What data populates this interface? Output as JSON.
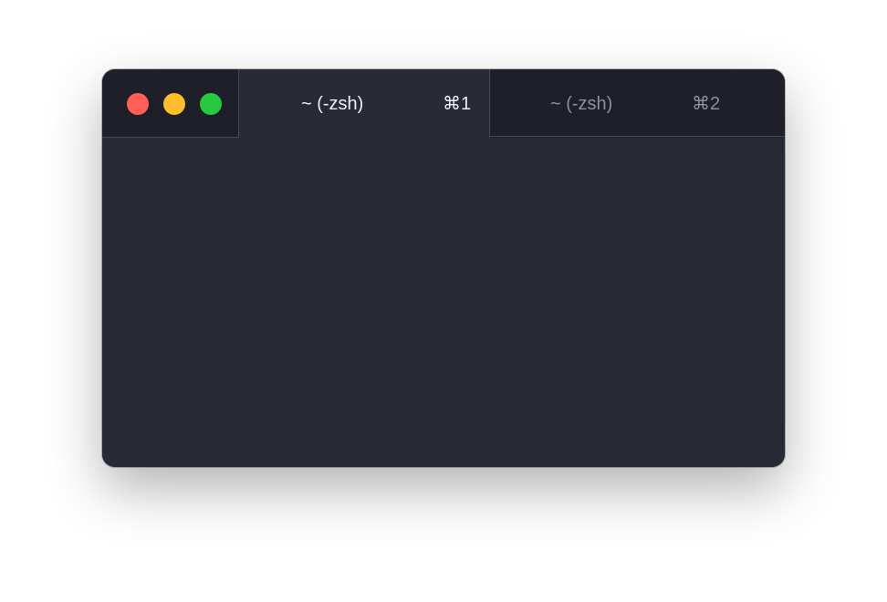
{
  "window": {
    "background_color": "#282a36",
    "titlebar_color": "#1e1f29"
  },
  "traffic_lights": [
    {
      "name": "close",
      "color": "#ff5f57"
    },
    {
      "name": "minimize",
      "color": "#febc2e"
    },
    {
      "name": "zoom",
      "color": "#28c840"
    }
  ],
  "tabs": [
    {
      "title": "~ (-zsh)",
      "shortcut": "⌘1",
      "active": true
    },
    {
      "title": "~ (-zsh)",
      "shortcut": "⌘2",
      "active": false
    }
  ]
}
